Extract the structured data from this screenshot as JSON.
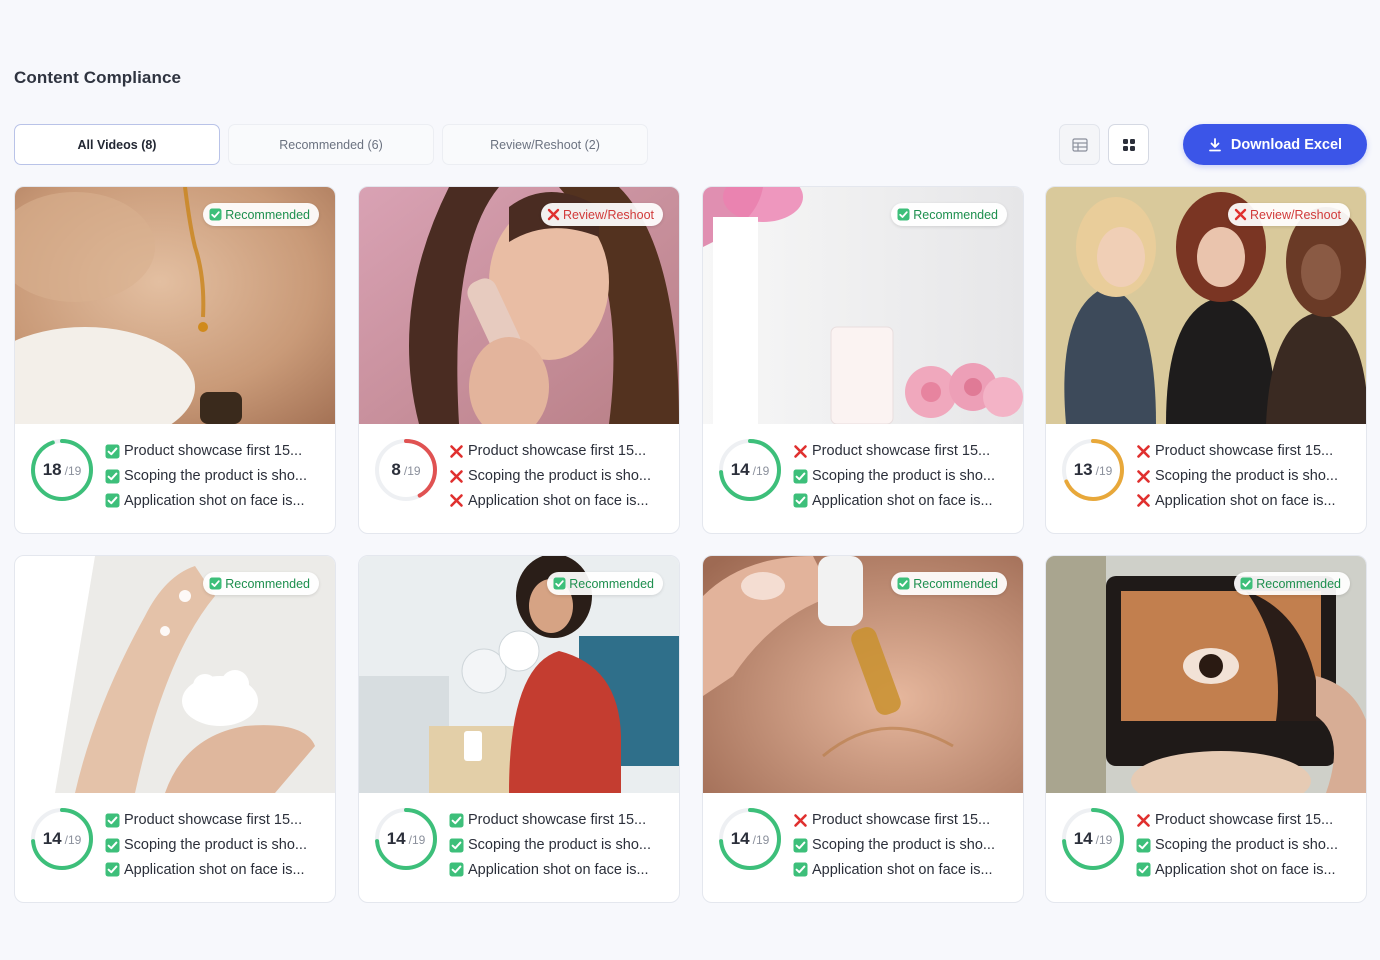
{
  "page": {
    "title": "Content Compliance"
  },
  "tabs": [
    {
      "label": "All Videos (8)",
      "active": true
    },
    {
      "label": "Recommended (6)",
      "active": false
    },
    {
      "label": "Review/Reshoot (2)",
      "active": false
    }
  ],
  "views": [
    {
      "icon": "table-view-icon",
      "active": false
    },
    {
      "icon": "grid-view-icon",
      "active": true
    }
  ],
  "download": {
    "label": "Download Excel",
    "icon": "download-icon"
  },
  "colors": {
    "accent": "#3b55e8",
    "pass": "#3dbf7a",
    "fail": "#e05252",
    "warn": "#e8a83a",
    "recommended": "#1d8f4e",
    "review": "#d13a3a"
  },
  "cards": [
    {
      "status": "Recommended",
      "status_type": "ok",
      "score": "18",
      "total": "/19",
      "score_fraction": 0.947,
      "ring": "pass",
      "checks": [
        {
          "text": "Product showcase first 15...",
          "pass": true
        },
        {
          "text": "Scoping the product is sho...",
          "pass": true
        },
        {
          "text": "Application shot on face is...",
          "pass": true
        }
      ]
    },
    {
      "status": "Review/Reshoot",
      "status_type": "bad",
      "score": "8",
      "total": "/19",
      "score_fraction": 0.421,
      "ring": "fail",
      "checks": [
        {
          "text": "Product showcase first 15...",
          "pass": false
        },
        {
          "text": "Scoping the product is sho...",
          "pass": false
        },
        {
          "text": "Application shot on face is...",
          "pass": false
        }
      ]
    },
    {
      "status": "Recommended",
      "status_type": "ok",
      "score": "14",
      "total": "/19",
      "score_fraction": 0.737,
      "ring": "pass",
      "checks": [
        {
          "text": "Product showcase first 15...",
          "pass": false
        },
        {
          "text": "Scoping the product is sho...",
          "pass": true
        },
        {
          "text": "Application shot on face is...",
          "pass": true
        }
      ]
    },
    {
      "status": "Review/Reshoot",
      "status_type": "bad",
      "score": "13",
      "total": "/19",
      "score_fraction": 0.684,
      "ring": "warn",
      "checks": [
        {
          "text": "Product showcase first 15...",
          "pass": false
        },
        {
          "text": "Scoping the product is sho...",
          "pass": false
        },
        {
          "text": "Application shot on face is...",
          "pass": false
        }
      ]
    },
    {
      "status": "Recommended",
      "status_type": "ok",
      "score": "14",
      "total": "/19",
      "score_fraction": 0.737,
      "ring": "pass",
      "checks": [
        {
          "text": "Product showcase first 15...",
          "pass": true
        },
        {
          "text": "Scoping the product is sho...",
          "pass": true
        },
        {
          "text": "Application shot on face is...",
          "pass": true
        }
      ]
    },
    {
      "status": "Recommended",
      "status_type": "ok",
      "score": "14",
      "total": "/19",
      "score_fraction": 0.737,
      "ring": "pass",
      "checks": [
        {
          "text": "Product showcase first 15...",
          "pass": true
        },
        {
          "text": "Scoping the product is sho...",
          "pass": true
        },
        {
          "text": "Application shot on face is...",
          "pass": true
        }
      ]
    },
    {
      "status": "Recommended",
      "status_type": "ok",
      "score": "14",
      "total": "/19",
      "score_fraction": 0.737,
      "ring": "pass",
      "checks": [
        {
          "text": "Product showcase first 15...",
          "pass": false
        },
        {
          "text": "Scoping the product is sho...",
          "pass": true
        },
        {
          "text": "Application shot on face is...",
          "pass": true
        }
      ]
    },
    {
      "status": "Recommended",
      "status_type": "ok",
      "score": "14",
      "total": "/19",
      "score_fraction": 0.737,
      "ring": "pass",
      "checks": [
        {
          "text": "Product showcase first 15...",
          "pass": false
        },
        {
          "text": "Scoping the product is sho...",
          "pass": true
        },
        {
          "text": "Application shot on face is...",
          "pass": true
        }
      ]
    }
  ]
}
